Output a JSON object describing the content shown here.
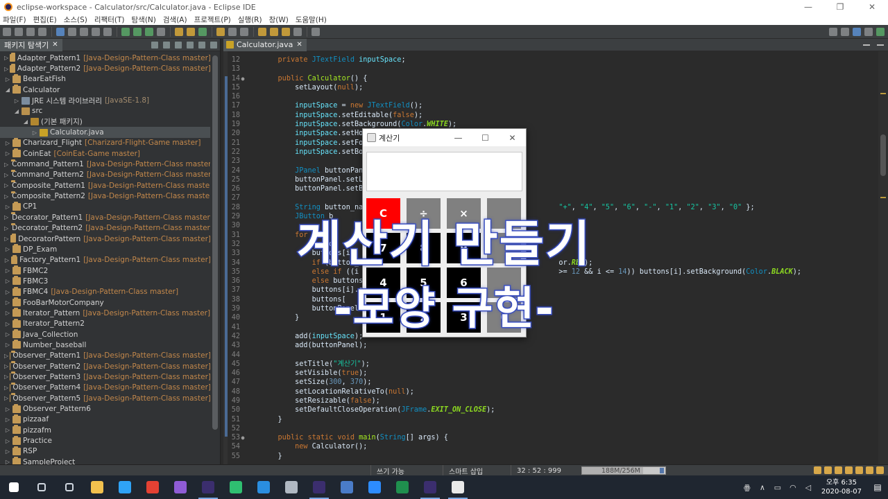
{
  "window": {
    "title": "eclipse-workspace - Calculator/src/Calculator.java - Eclipse IDE",
    "controls": [
      "—",
      "❐",
      "✕"
    ]
  },
  "menu": [
    "파일(F)",
    "편집(E)",
    "소스(S)",
    "리팩터(T)",
    "탐색(N)",
    "검색(A)",
    "프로젝트(P)",
    "실행(R)",
    "창(W)",
    "도움말(H)"
  ],
  "explorer": {
    "tab_label": "패키지 탐색기",
    "close_glyph": "✕",
    "items": [
      {
        "arrow": "▷",
        "icon": "proj",
        "name": "Adapter_Pattern1",
        "repo": "[Java-Design-Pattern-Class master]",
        "indent": 0
      },
      {
        "arrow": "▷",
        "icon": "proj",
        "name": "Adapter_Pattern2",
        "repo": "[Java-Design-Pattern-Class master]",
        "indent": 0
      },
      {
        "arrow": "▷",
        "icon": "proj",
        "name": "BearEatFish",
        "repo": "",
        "indent": 0
      },
      {
        "arrow": "◢",
        "icon": "proj",
        "name": "Calculator",
        "repo": "",
        "indent": 0
      },
      {
        "arrow": "▷",
        "icon": "jre",
        "name": "JRE 시스템 라이브러리",
        "repo": "[JavaSE-1.8]",
        "indent": 1
      },
      {
        "arrow": "◢",
        "icon": "src",
        "name": "src",
        "repo": "",
        "indent": 1
      },
      {
        "arrow": "◢",
        "icon": "pkg",
        "name": "(기본 패키지)",
        "repo": "",
        "indent": 2
      },
      {
        "arrow": "▷",
        "icon": "java",
        "name": "Calculator.java",
        "repo": "",
        "indent": 3,
        "selected": true
      },
      {
        "arrow": "▷",
        "icon": "proj",
        "name": "Charizard_Flight",
        "repo": "[Charizard-Flight-Game master]",
        "indent": 0
      },
      {
        "arrow": "▷",
        "icon": "proj",
        "name": "CoinEat",
        "repo": "[CoinEat-Game master]",
        "indent": 0
      },
      {
        "arrow": "▷",
        "icon": "proj",
        "name": "Command_Pattern1",
        "repo": "[Java-Design-Pattern-Class master]",
        "indent": 0
      },
      {
        "arrow": "▷",
        "icon": "proj",
        "name": "Command_Pattern2",
        "repo": "[Java-Design-Pattern-Class master]",
        "indent": 0
      },
      {
        "arrow": "▷",
        "icon": "proj",
        "name": "Composite_Pattern1",
        "repo": "[Java-Design-Pattern-Class master]",
        "indent": 0
      },
      {
        "arrow": "▷",
        "icon": "proj",
        "name": "Composite_Pattern2",
        "repo": "[Java-Design-Pattern-Class master]",
        "indent": 0
      },
      {
        "arrow": "▷",
        "icon": "proj",
        "name": "CP1",
        "repo": "",
        "indent": 0
      },
      {
        "arrow": "▷",
        "icon": "proj",
        "name": "Decorator_Pattern1",
        "repo": "[Java-Design-Pattern-Class master]",
        "indent": 0
      },
      {
        "arrow": "▷",
        "icon": "proj",
        "name": "Decorator_Pattern2",
        "repo": "[Java-Design-Pattern-Class master]",
        "indent": 0
      },
      {
        "arrow": "▷",
        "icon": "proj",
        "name": "DecoratorPattern",
        "repo": "[Java-Design-Pattern-Class master]",
        "indent": 0
      },
      {
        "arrow": "▷",
        "icon": "proj",
        "name": "DP_Exam",
        "repo": "",
        "indent": 0
      },
      {
        "arrow": "▷",
        "icon": "proj",
        "name": "Factory_Pattern1",
        "repo": "[Java-Design-Pattern-Class master]",
        "indent": 0
      },
      {
        "arrow": "▷",
        "icon": "proj",
        "name": "FBMC2",
        "repo": "",
        "indent": 0
      },
      {
        "arrow": "▷",
        "icon": "proj",
        "name": "FBMC3",
        "repo": "",
        "indent": 0
      },
      {
        "arrow": "▷",
        "icon": "proj",
        "name": "FBMC4",
        "repo": "[Java-Design-Pattern-Class master]",
        "indent": 0
      },
      {
        "arrow": "▷",
        "icon": "proj",
        "name": "FooBarMotorCompany",
        "repo": "",
        "indent": 0
      },
      {
        "arrow": "▷",
        "icon": "proj",
        "name": "Iterator_Pattern",
        "repo": "[Java-Design-Pattern-Class master]",
        "indent": 0
      },
      {
        "arrow": "▷",
        "icon": "proj",
        "name": "Iterator_Pattern2",
        "repo": "",
        "indent": 0
      },
      {
        "arrow": "▷",
        "icon": "proj",
        "name": "Java_Collection",
        "repo": "",
        "indent": 0
      },
      {
        "arrow": "▷",
        "icon": "proj",
        "name": "Number_baseball",
        "repo": "",
        "indent": 0
      },
      {
        "arrow": "▷",
        "icon": "proj",
        "name": "Observer_Pattern1",
        "repo": "[Java-Design-Pattern-Class master]",
        "indent": 0
      },
      {
        "arrow": "▷",
        "icon": "proj",
        "name": "Observer_Pattern2",
        "repo": "[Java-Design-Pattern-Class master]",
        "indent": 0
      },
      {
        "arrow": "▷",
        "icon": "proj",
        "name": "Observer_Pattern3",
        "repo": "[Java-Design-Pattern-Class master]",
        "indent": 0
      },
      {
        "arrow": "▷",
        "icon": "proj",
        "name": "Observer_Pattern4",
        "repo": "[Java-Design-Pattern-Class master]",
        "indent": 0
      },
      {
        "arrow": "▷",
        "icon": "proj",
        "name": "Observer_Pattern5",
        "repo": "[Java-Design-Pattern-Class master]",
        "indent": 0
      },
      {
        "arrow": "▷",
        "icon": "proj",
        "name": "Observer_Pattern6",
        "repo": "",
        "indent": 0
      },
      {
        "arrow": "▷",
        "icon": "proj",
        "name": "pizzaaf",
        "repo": "",
        "indent": 0
      },
      {
        "arrow": "▷",
        "icon": "proj",
        "name": "pizzafm",
        "repo": "",
        "indent": 0
      },
      {
        "arrow": "▷",
        "icon": "proj",
        "name": "Practice",
        "repo": "",
        "indent": 0
      },
      {
        "arrow": "▷",
        "icon": "proj",
        "name": "RSP",
        "repo": "",
        "indent": 0
      },
      {
        "arrow": "▷",
        "icon": "proj",
        "name": "SampleProject",
        "repo": "",
        "indent": 0
      }
    ]
  },
  "editor": {
    "tab_label": "Calculator.java",
    "close_glyph": "✕",
    "lines": [
      {
        "n": "12",
        "fold": "",
        "html": "    <span class='k'>private</span> <span class='t'>JTextField</span> <span class='v'>inputSpace</span>;"
      },
      {
        "n": "13",
        "fold": "",
        "html": ""
      },
      {
        "n": "14",
        "fold": "●",
        "html": "    <span class='k'>public</span> <span class='m'>Calculator</span>() {"
      },
      {
        "n": "15",
        "fold": "",
        "html": "        setLayout(<span class='k'>null</span>);"
      },
      {
        "n": "16",
        "fold": "",
        "html": ""
      },
      {
        "n": "17",
        "fold": "",
        "html": "        <span class='v'>inputSpace</span> = <span class='k'>new</span> <span class='t'>JTextField</span>();"
      },
      {
        "n": "18",
        "fold": "",
        "html": "        <span class='v'>inputSpace</span>.setEditable(<span class='k'>false</span>);"
      },
      {
        "n": "19",
        "fold": "",
        "html": "        <span class='v'>inputSpace</span>.setBackground(<span class='t'>Color</span>.<span class='f'>WHITE</span>);"
      },
      {
        "n": "20",
        "fold": "",
        "html": "        <span class='v'>inputSpace</span>.setHorizo"
      },
      {
        "n": "21",
        "fold": "",
        "html": "        <span class='v'>inputSpace</span>.setFont(n"
      },
      {
        "n": "22",
        "fold": "",
        "html": "        <span class='v'>inputSpace</span>.setBounds"
      },
      {
        "n": "23",
        "fold": "",
        "html": ""
      },
      {
        "n": "24",
        "fold": "",
        "html": "        <span class='t'>JPanel</span> buttonPanel ="
      },
      {
        "n": "25",
        "fold": "",
        "html": "        buttonPanel.setLayou"
      },
      {
        "n": "26",
        "fold": "",
        "html": "        buttonPanel.setBound"
      },
      {
        "n": "27",
        "fold": "",
        "html": ""
      },
      {
        "n": "28",
        "fold": "",
        "html": "        <span class='t'>String</span> button_names[                                          <span class='s'>\"+\"</span>, <span class='s'>\"4\"</span>, <span class='s'>\"5\"</span>, <span class='s'>\"6\"</span>, <span class='s'>\"-\"</span>, <span class='s'>\"1\"</span>, <span class='s'>\"2\"</span>, <span class='s'>\"3\"</span>, <span class='s'>\"0\"</span> };"
      },
      {
        "n": "29",
        "fold": "",
        "html": "        <span class='t'>JButton</span> b"
      },
      {
        "n": "30",
        "fold": "",
        "html": ""
      },
      {
        "n": "31",
        "fold": "",
        "html": "        <span class='k'>for</span> (<span class='k'>int</span> i"
      },
      {
        "n": "32",
        "fold": "",
        "html": "            button"
      },
      {
        "n": "33",
        "fold": "",
        "html": "            buttons[i]"
      },
      {
        "n": "34",
        "fold": "",
        "html": "            <span class='k'>if</span> (button_names                                          or.<span class='f'>RED</span>);"
      },
      {
        "n": "35",
        "fold": "",
        "html": "            <span class='k'>else if</span> ((i >= 4                                          >= <span class='n'>12</span> && i <= <span class='n'>14</span>)) buttons[i].setBackground(<span class='t'>Color</span>.<span class='f'>BLACK</span>);"
      },
      {
        "n": "36",
        "fold": "",
        "html": "            <span class='k'>else</span> buttons[i]."
      },
      {
        "n": "37",
        "fold": "",
        "html": "            buttons[i].setFo"
      },
      {
        "n": "38",
        "fold": "",
        "html": "            buttons["
      },
      {
        "n": "39",
        "fold": "",
        "html": "            buttonPanel.add"
      },
      {
        "n": "40",
        "fold": "",
        "html": "        }"
      },
      {
        "n": "41",
        "fold": "",
        "html": ""
      },
      {
        "n": "42",
        "fold": "",
        "html": "        add(<span class='v'>inputSpace</span>);"
      },
      {
        "n": "43",
        "fold": "",
        "html": "        add(buttonPanel);"
      },
      {
        "n": "44",
        "fold": "",
        "html": ""
      },
      {
        "n": "45",
        "fold": "",
        "html": "        setTitle(<span class='s'>\"계산기\"</span>);"
      },
      {
        "n": "46",
        "fold": "",
        "html": "        setVisible(<span class='k'>true</span>);"
      },
      {
        "n": "47",
        "fold": "",
        "html": "        setSize(<span class='n'>300</span>, <span class='n'>370</span>);"
      },
      {
        "n": "48",
        "fold": "",
        "html": "        setLocationRelativeTo(<span class='k'>null</span>);"
      },
      {
        "n": "49",
        "fold": "",
        "html": "        setResizable(<span class='k'>false</span>);"
      },
      {
        "n": "50",
        "fold": "",
        "html": "        setDefaultCloseOperation(<span class='t'>JFrame</span>.<span class='f'>EXIT_ON_CLOSE</span>);"
      },
      {
        "n": "51",
        "fold": "",
        "html": "    }"
      },
      {
        "n": "52",
        "fold": "",
        "html": ""
      },
      {
        "n": "53",
        "fold": "●",
        "html": "    <span class='k'>public static void</span> <span class='m'>main</span>(<span class='t'>String</span>[] args) {"
      },
      {
        "n": "54",
        "fold": "",
        "html": "        <span class='k'>new</span> Calculator();"
      },
      {
        "n": "55",
        "fold": "",
        "html": "    }"
      }
    ]
  },
  "statusbar": {
    "writable": "쓰기 가능",
    "insert_mode": "스마트 삽입",
    "position": "32 : 52 : 999",
    "heap": "188M/256M",
    "heap_used_fraction": 0.73
  },
  "calculator_window": {
    "title": "계산기",
    "controls": [
      "—",
      "☐",
      "✕"
    ],
    "keys": [
      {
        "label": "C",
        "color": "red"
      },
      {
        "label": "÷",
        "color": "gray"
      },
      {
        "label": "×",
        "color": "gray"
      },
      {
        "label": "",
        "color": "gray"
      },
      {
        "label": "7",
        "color": "black"
      },
      {
        "label": "8",
        "color": "black"
      },
      {
        "label": "9",
        "color": "black"
      },
      {
        "label": "",
        "color": "gray"
      },
      {
        "label": "4",
        "color": "black"
      },
      {
        "label": "5",
        "color": "black"
      },
      {
        "label": "6",
        "color": "black"
      },
      {
        "label": "",
        "color": "gray"
      },
      {
        "label": "1",
        "color": "black"
      },
      {
        "label": "2",
        "color": "black"
      },
      {
        "label": "3",
        "color": "black"
      },
      {
        "label": "0",
        "color": "gray"
      }
    ]
  },
  "caption": {
    "line1": "계산기 만들기",
    "line2": "-모양 구현-"
  },
  "taskbar": {
    "apps": [
      {
        "name": "windows-start",
        "color": "#ffffff"
      },
      {
        "name": "search",
        "color": "#cfd6df"
      },
      {
        "name": "task-view",
        "color": "#cfd6df"
      },
      {
        "name": "file-explorer",
        "color": "#f2c14e"
      },
      {
        "name": "photoshop",
        "color": "#2fa3f7"
      },
      {
        "name": "chrome",
        "color": "#e34133"
      },
      {
        "name": "visual-studio",
        "color": "#8f5cd6"
      },
      {
        "name": "eclipse",
        "color": "#3b2e6e"
      },
      {
        "name": "maps",
        "color": "#2fbf71"
      },
      {
        "name": "vscode",
        "color": "#2a8ee0"
      },
      {
        "name": "database",
        "color": "#b0b8c2"
      },
      {
        "name": "eclipse-2",
        "color": "#3b2e6e"
      },
      {
        "name": "r-app",
        "color": "#4a7cc8"
      },
      {
        "name": "zoom",
        "color": "#2d8cff"
      },
      {
        "name": "excel",
        "color": "#1f8f4e"
      },
      {
        "name": "eclipse-3",
        "color": "#3b2e6e"
      },
      {
        "name": "java",
        "color": "#e9e9e9"
      }
    ],
    "time": "오후 6:35",
    "date": "2020-08-07"
  }
}
